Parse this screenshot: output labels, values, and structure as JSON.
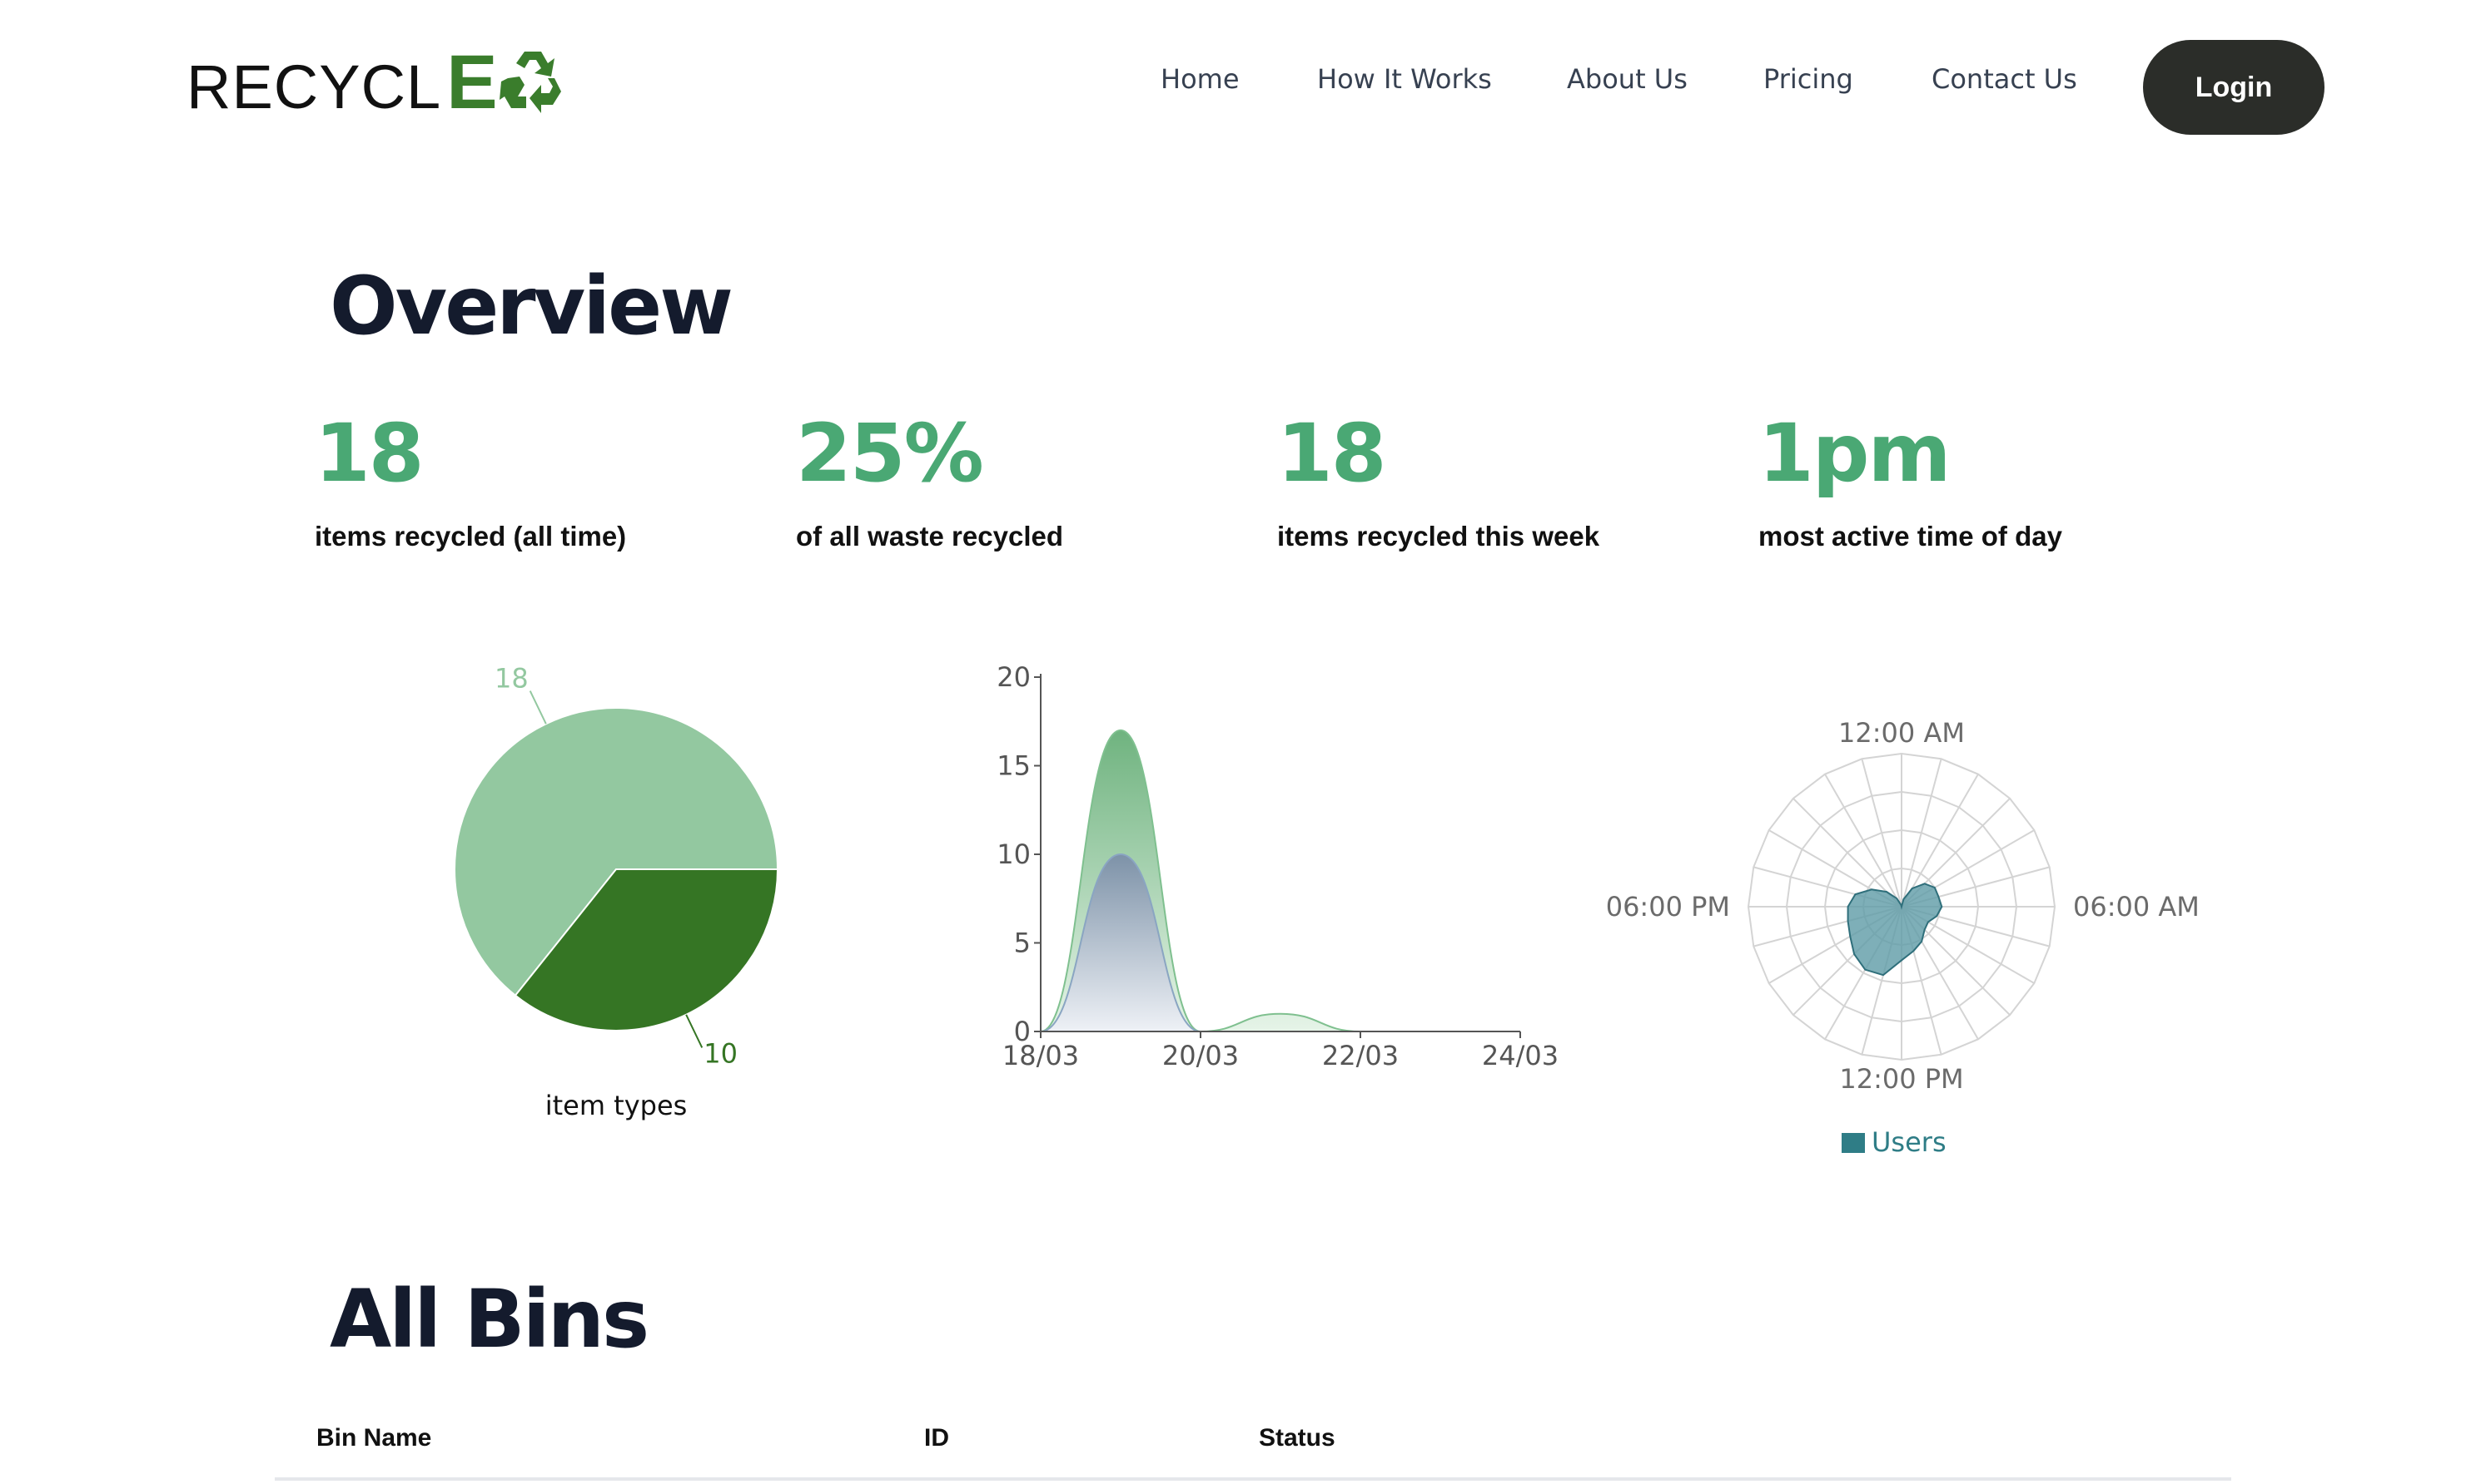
{
  "header": {
    "logo_text": "RECYCL",
    "logo_letter": "E",
    "nav": [
      {
        "label": "Home"
      },
      {
        "label": "How It Works"
      },
      {
        "label": "About Us"
      },
      {
        "label": "Pricing"
      },
      {
        "label": "Contact Us"
      }
    ],
    "login_label": "Login"
  },
  "overview": {
    "title": "Overview",
    "stats": [
      {
        "value": "18",
        "label": "items recycled (all time)"
      },
      {
        "value": "25%",
        "label": "of all waste recycled"
      },
      {
        "value": "18",
        "label": "items recycled this week"
      },
      {
        "value": "1pm",
        "label": "most active time of day"
      }
    ]
  },
  "colors": {
    "accent_green": "#4aa874",
    "pie_light": "#93c8a0",
    "pie_dark": "#357524",
    "radar_fill": "#5e9ba6",
    "radar_stroke": "#2f6f7b",
    "legend_text": "#2f7d86",
    "login_bg": "#2b2d29"
  },
  "chart_data": [
    {
      "type": "pie",
      "title": "item types",
      "slices": [
        {
          "value": 18,
          "color": "#93c8a0"
        },
        {
          "value": 10,
          "color": "#357524"
        }
      ],
      "labels": [
        "18",
        "10"
      ]
    },
    {
      "type": "area",
      "x_ticks": [
        "18/03",
        "20/03",
        "22/03",
        "24/03"
      ],
      "y_ticks": [
        "0",
        "5",
        "10",
        "15",
        "20"
      ],
      "ylim": [
        0,
        20
      ],
      "x": [
        "18/03",
        "19/03",
        "20/03",
        "21/03",
        "22/03",
        "23/03",
        "24/03"
      ],
      "series": [
        {
          "values": [
            0,
            17,
            0,
            1,
            0,
            0,
            0
          ],
          "color": "#7fc08f"
        },
        {
          "values": [
            0,
            10,
            0,
            0,
            0,
            0,
            0
          ],
          "color": "#8aa5c2"
        }
      ],
      "grid": false
    },
    {
      "type": "radar",
      "axis_labels": [
        "12:00 AM",
        "06:00 AM",
        "12:00 PM",
        "06:00 PM"
      ],
      "hours": [
        0,
        1,
        2,
        3,
        4,
        5,
        6,
        7,
        8,
        9,
        10,
        11,
        12,
        13,
        14,
        15,
        16,
        17,
        18,
        19,
        20,
        21,
        22,
        23
      ],
      "series": [
        {
          "name": "Users",
          "values": [
            0,
            0.2,
            0.55,
            0.85,
            1.0,
            1.0,
            1.05,
            0.95,
            0.8,
            0.85,
            1.05,
            1.2,
            1.4,
            1.85,
            1.9,
            1.75,
            1.55,
            1.45,
            1.4,
            1.25,
            0.9,
            0.55,
            0.25,
            0.05
          ]
        }
      ],
      "rmax": 4,
      "legend": "bottom",
      "grid": true
    }
  ],
  "bins": {
    "title": "All Bins",
    "columns": [
      "Bin Name",
      "ID",
      "Status"
    ]
  }
}
